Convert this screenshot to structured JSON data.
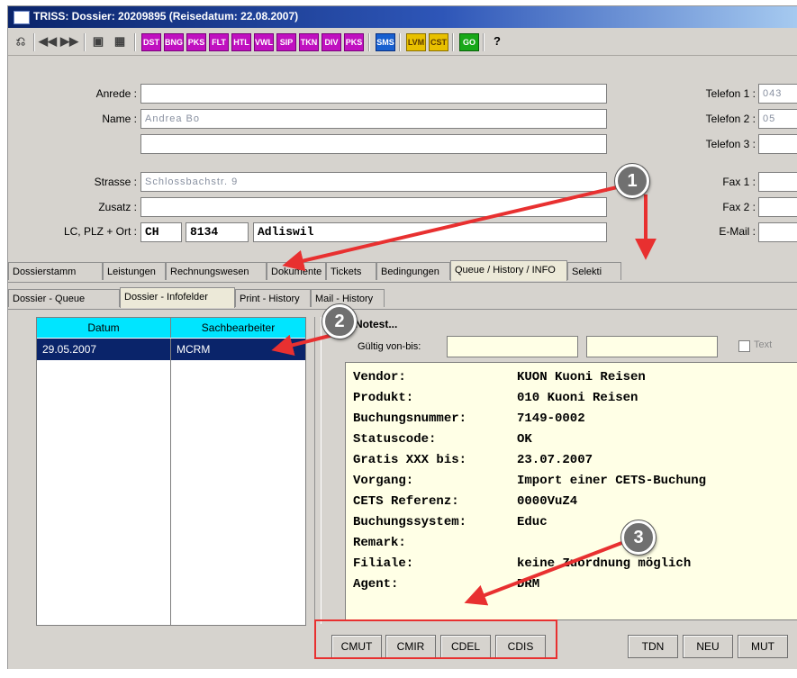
{
  "window": {
    "title": "TRISS: Dossier: 20209895 (Reisedatum: 22.08.2007)"
  },
  "toolbar": {
    "nav_icons": [
      "print-icon",
      "first-icon",
      "last-icon",
      "disk-icon",
      "table-icon"
    ],
    "tool_buttons": [
      "DST",
      "BNG",
      "PKS",
      "FLT",
      "HTL",
      "VWL",
      "SIP",
      "TKN",
      "DIV",
      "PKS",
      "SMS",
      "LVM",
      "CST",
      "GO",
      "?"
    ]
  },
  "form": {
    "anrede_label": "Anrede :",
    "name_label": "Name :",
    "name_value": "Andrea Bo",
    "strasse_label": "Strasse :",
    "strasse_value": "Schlossbachstr. 9",
    "zusatz_label": "Zusatz :",
    "lcplz_label": "LC, PLZ + Ort :",
    "lc_value": "CH",
    "plz_value": "8134",
    "ort_value": "Adliswil",
    "telefon1_label": "Telefon 1 :",
    "telefon1_value": "043",
    "telefon2_label": "Telefon 2 :",
    "telefon2_value": "05",
    "telefon3_label": "Telefon 3 :",
    "fax1_label": "Fax 1 :",
    "fax2_label": "Fax 2 :",
    "email_label": "E-Mail :"
  },
  "main_tabs": [
    "Dossierstamm",
    "Leistungen",
    "Rechnungswesen",
    "Dokumente",
    "Tickets",
    "Bedingungen",
    "Queue / History / INFO",
    "Selekti"
  ],
  "sub_tabs": [
    "Dossier - Queue",
    "Dossier - Infofelder",
    "Print - History",
    "Mail - History"
  ],
  "grid": {
    "headers": [
      "Datum",
      "Sachbearbeiter"
    ],
    "rows": [
      {
        "datum": "29.05.2007",
        "sachbearbeiter": "MCRM"
      }
    ]
  },
  "info": {
    "notes_label": "Notest...",
    "gueltig_label": "Gültig von-bis:",
    "text_checkbox_label": "Text",
    "lines": [
      {
        "key": "Vendor:",
        "value": "KUON   Kuoni Reisen"
      },
      {
        "key": "Produkt:",
        "value": "010    Kuoni Reisen"
      },
      {
        "key": "Buchungsnummer:",
        "value": "7149-0002"
      },
      {
        "key": "Statuscode:",
        "value": "OK"
      },
      {
        "key": "Gratis XXX bis:",
        "value": "23.07.2007"
      },
      {
        "key": "Vorgang:",
        "value": "Import einer CETS-Buchung"
      },
      {
        "key": "CETS Referenz:",
        "value": "0000VuZ4"
      },
      {
        "key": "Buchungssystem:",
        "value": "Educ"
      },
      {
        "key": "Remark:",
        "value": ""
      },
      {
        "key": "Filiale:",
        "value": "keine Zuordnung möglich"
      },
      {
        "key": "Agent:",
        "value": "DRM"
      }
    ]
  },
  "buttons": {
    "left": [
      "CMUT",
      "CMIR",
      "CDEL",
      "CDIS"
    ],
    "right": [
      "TDN",
      "NEU",
      "MUT"
    ]
  },
  "callouts": [
    "1",
    "2",
    "3"
  ],
  "colors": {
    "title": "#0a246a",
    "header": "#00e5ff",
    "selected": "#0a246a",
    "info_bg": "#ffffe6",
    "arrow": "#e83030"
  }
}
